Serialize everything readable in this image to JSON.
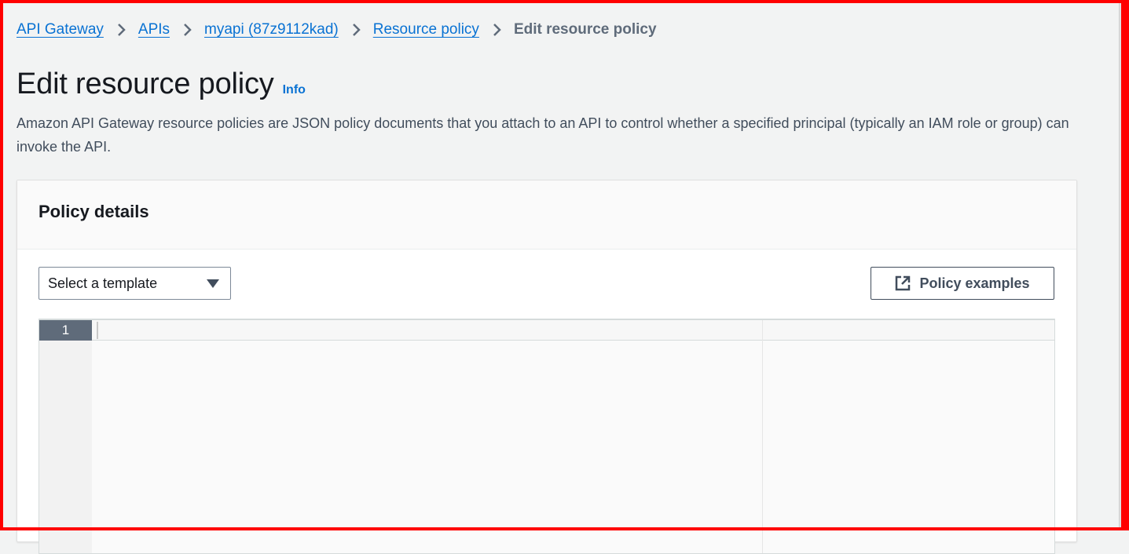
{
  "breadcrumb": {
    "items": [
      {
        "label": "API Gateway"
      },
      {
        "label": "APIs"
      },
      {
        "label": "myapi (87z9112kad)"
      },
      {
        "label": "Resource policy"
      }
    ],
    "current": "Edit resource policy"
  },
  "header": {
    "title": "Edit resource policy",
    "info_label": "Info",
    "description": "Amazon API Gateway resource policies are JSON policy documents that you attach to an API to control whether a specified principal (typically an IAM role or group) can invoke the API."
  },
  "policy_details": {
    "title": "Policy details",
    "template_select": {
      "selected": "Select a template"
    },
    "policy_examples_button": {
      "label": "Policy examples",
      "icon": "external-link-icon"
    },
    "editor": {
      "line_numbers": [
        "1"
      ],
      "content": ""
    }
  },
  "colors": {
    "link": "#0972d3",
    "background": "#f2f3f3",
    "text": "#16191f",
    "secondary_text": "#414d5c",
    "gutter_active": "#5f6b7a"
  }
}
